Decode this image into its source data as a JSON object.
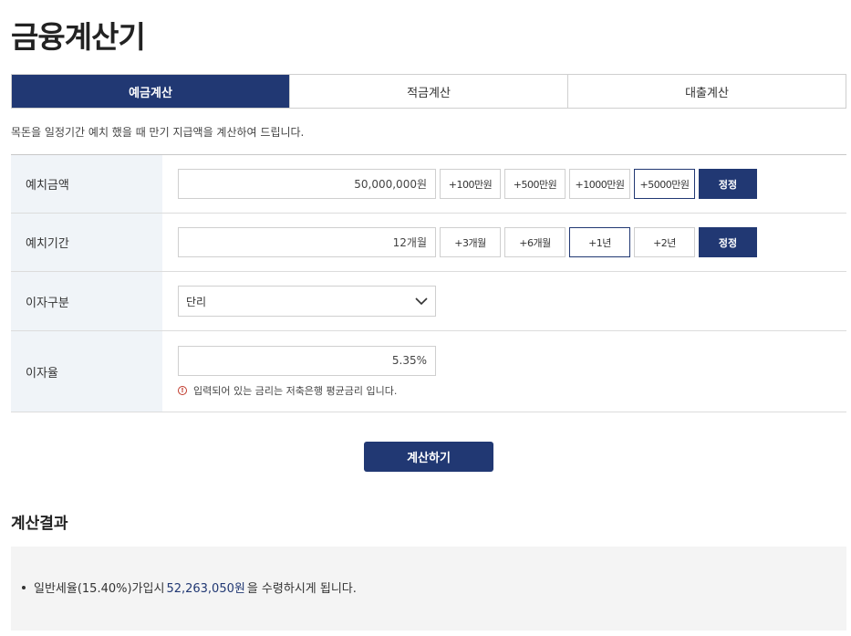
{
  "title": "금융계산기",
  "tabs": [
    {
      "label": "예금계산",
      "active": true
    },
    {
      "label": "적금계산",
      "active": false
    },
    {
      "label": "대출계산",
      "active": false
    }
  ],
  "description": "목돈을 일정기간 예치 했을 때 만기 지급액을 계산하여 드립니다.",
  "rows": {
    "deposit_amount": {
      "label": "예치금액",
      "value": "50,000,000원",
      "chips": [
        "+100만원",
        "+500만원",
        "+1000만원",
        "+5000만원"
      ],
      "selected_chip": 3,
      "correct_label": "정정"
    },
    "deposit_period": {
      "label": "예치기간",
      "value": "12개월",
      "chips": [
        "+3개월",
        "+6개월",
        "+1년",
        "+2년"
      ],
      "selected_chip": 2,
      "correct_label": "정정"
    },
    "interest_type": {
      "label": "이자구분",
      "selected": "단리"
    },
    "interest_rate": {
      "label": "이자율",
      "value": "5.35%",
      "notice": "입력되어 있는 금리는 저축은행 평균금리 입니다."
    }
  },
  "calculate_label": "계산하기",
  "result": {
    "title": "계산결과",
    "prefix": "일반세율(15.40%)가입시",
    "amount": "52,263,050원",
    "suffix": "을 수령하시게 됩니다."
  },
  "colors": {
    "accent": "#213873",
    "label_bg": "#f0f4f8",
    "result_bg": "#f4f4f4",
    "notice": "#c0392b"
  },
  "icons": {
    "dropdown": "chevron-down-icon",
    "notice": "info-circle-icon"
  }
}
